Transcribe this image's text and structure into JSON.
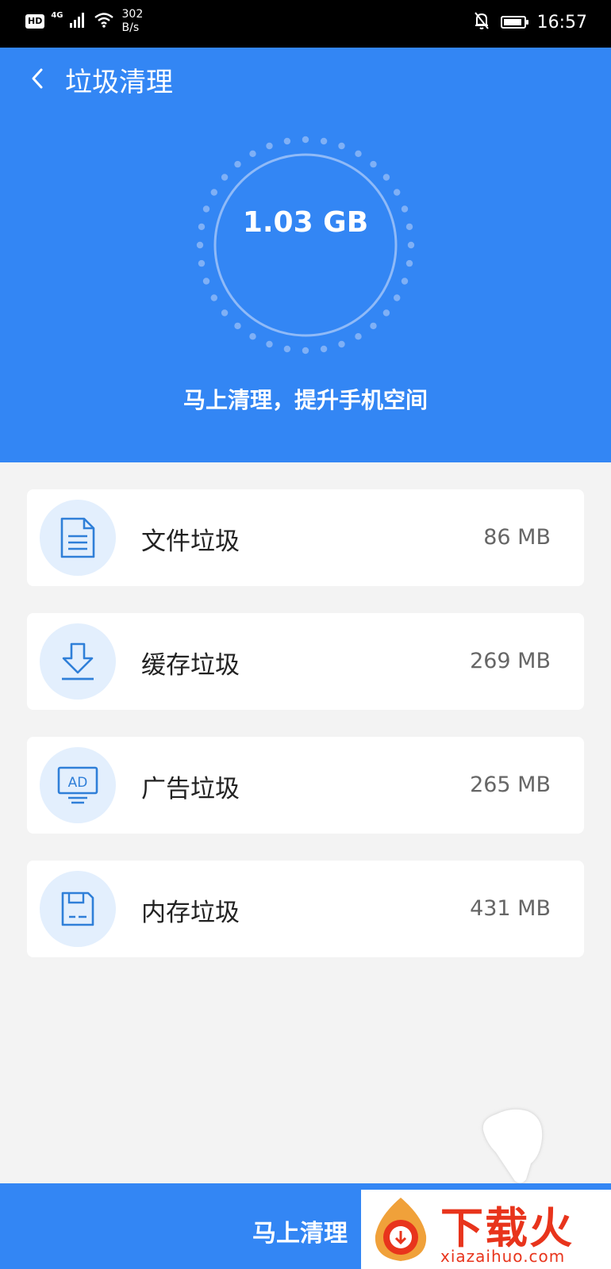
{
  "status_bar": {
    "hd_badge": "HD",
    "network_type": "4G",
    "speed_value": "302",
    "speed_unit": "B/s",
    "time": "16:57"
  },
  "header": {
    "title": "垃圾清理"
  },
  "summary": {
    "total_size": "1.03 GB",
    "subtitle": "马上清理，提升手机空间"
  },
  "junk_items": [
    {
      "label": "文件垃圾",
      "size": "86 MB",
      "icon": "document-icon"
    },
    {
      "label": "缓存垃圾",
      "size": "269 MB",
      "icon": "download-icon"
    },
    {
      "label": "广告垃圾",
      "size": "265 MB",
      "icon": "ad-monitor-icon"
    },
    {
      "label": "内存垃圾",
      "size": "431 MB",
      "icon": "memory-card-icon"
    }
  ],
  "action": {
    "clean_label": "马上清理"
  },
  "watermark": {
    "brand": "下载火",
    "url": "xiazaihuo.com"
  },
  "colors": {
    "primary": "#3386f4",
    "icon_bg": "#e3effd",
    "icon_stroke": "#2f7fd8",
    "watermark": "#e8341c"
  }
}
